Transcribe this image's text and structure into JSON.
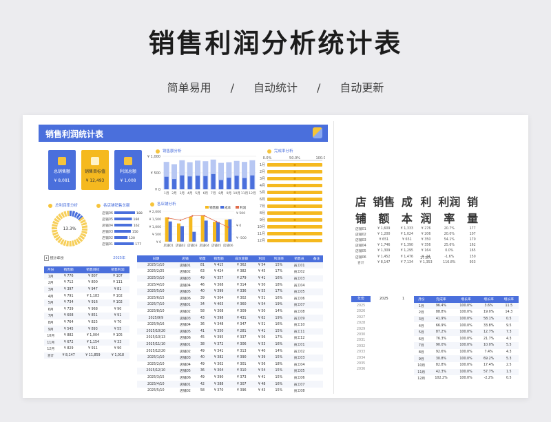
{
  "hero": {
    "title": "销售利润分析统计表",
    "tags": [
      "简单易用",
      "/",
      "自动统计",
      "/",
      "自动更新"
    ]
  },
  "dashboard": {
    "title": "销售利润统计表",
    "kpis": [
      {
        "label": "总销售额",
        "value": "¥ 8,081",
        "color": "#4a6fdc"
      },
      {
        "label": "销售目标值",
        "value": "¥ 12,493",
        "color": "#f5b91f"
      },
      {
        "label": "利润总额",
        "value": "¥ 1,008",
        "color": "#4a6fdc"
      }
    ],
    "panels": {
      "sales_trend": "销售额分析",
      "completion": "完成率分析",
      "profit_rate": "总利润率分析",
      "store_sales": "各店铺销售总额",
      "store_analysis": "各店铺分析"
    },
    "profit_rate_value": "13.3%"
  },
  "chart_data": [
    {
      "type": "bar",
      "title": "销售额分析",
      "categories": [
        "1月",
        "2月",
        "3月",
        "4月",
        "5月",
        "6月",
        "7月",
        "8月",
        "9月",
        "10月",
        "11月",
        "12月"
      ],
      "yticks": [
        "¥ 1,000",
        "¥ 500",
        "¥ 0"
      ],
      "ylim": [
        0,
        1000
      ],
      "series": [
        {
          "values": [
            830,
            760,
            880,
            820,
            870,
            850,
            900,
            800,
            820,
            860,
            830,
            880
          ]
        },
        {
          "values": [
            380,
            310,
            420,
            390,
            410,
            400,
            460,
            280,
            350,
            410,
            340,
            420
          ]
        }
      ]
    },
    {
      "type": "bar",
      "title": "完成率分析",
      "orientation": "horizontal",
      "categories": [
        "1月",
        "2月",
        "3月",
        "4月",
        "5月",
        "6月",
        "7月",
        "8月",
        "9月",
        "10月",
        "11月",
        "12月"
      ],
      "xticks": [
        "0.0%",
        "50.0%",
        "100.0%"
      ],
      "xlim": [
        0,
        1
      ],
      "values": [
        1.0,
        1.0,
        1.0,
        1.0,
        1.0,
        1.0,
        1.0,
        1.0,
        1.0,
        1.0,
        1.0,
        1.0
      ]
    },
    {
      "type": "bar",
      "title": "各店铺销售总额",
      "orientation": "horizontal",
      "categories": [
        "店铺06",
        "店铺05",
        "店铺04",
        "店铺03",
        "店铺02",
        "店铺01"
      ],
      "values": [
        188,
        160,
        162,
        150,
        120,
        177
      ]
    },
    {
      "type": "bar",
      "title": "各店铺分析",
      "categories": [
        "店铺01",
        "店铺02",
        "店铺03",
        "店铺04",
        "店铺05",
        "店铺06"
      ],
      "legend": [
        "销售额",
        "成本",
        "利润"
      ],
      "yticks_left": [
        "¥ 2,000",
        "¥ 1,500",
        "¥ 1,000",
        "¥ 500",
        "¥ 0"
      ],
      "yticks_right": [
        "¥ 500",
        "¥ 0",
        "¥ -500"
      ],
      "series": [
        {
          "name": "销售额",
          "values": [
            1609,
            1200,
            1651,
            1746,
            1309,
            1452
          ]
        },
        {
          "name": "成本",
          "values": [
            1333,
            1024,
            651,
            1390,
            1295,
            1476
          ]
        },
        {
          "name": "利润",
          "values": [
            276,
            206,
            350,
            356,
            164,
            -24
          ]
        }
      ]
    },
    {
      "type": "pie",
      "title": "总利润率分析",
      "values": [
        13.3,
        86.7
      ]
    }
  ],
  "year_panel": {
    "label": "统计年份",
    "year": "2025年",
    "headers": [
      "月份",
      "销售额",
      "销售目标",
      "销售利润"
    ],
    "rows": [
      [
        "1月",
        "¥ 776",
        "¥ 807",
        "¥ 107"
      ],
      [
        "2月",
        "¥ 712",
        "¥ 800",
        "¥ 111"
      ],
      [
        "3月",
        "¥ 397",
        "¥ 947",
        "¥ 81"
      ],
      [
        "4月",
        "¥ 791",
        "¥ 1,183",
        "¥ 102"
      ],
      [
        "5月",
        "¥ 734",
        "¥ 916",
        "¥ 102"
      ],
      [
        "6月",
        "¥ 739",
        "¥ 968",
        "¥ 90"
      ],
      [
        "7月",
        "¥ 608",
        "¥ 851",
        "¥ 91"
      ],
      [
        "8月",
        "¥ 764",
        "¥ 825",
        "¥ 70"
      ],
      [
        "9月",
        "¥ 545",
        "¥ 893",
        "¥ 55"
      ],
      [
        "10月",
        "¥ 882",
        "¥ 1,004",
        "¥ 105"
      ],
      [
        "11月",
        "¥ 672",
        "¥ 1,154",
        "¥ 33"
      ],
      [
        "12月",
        "¥ 829",
        "¥ 911",
        "¥ 90"
      ],
      [
        "合计",
        "¥ 8,147",
        "¥ 11,859",
        "¥ 1,018"
      ]
    ]
  },
  "records": {
    "headers": [
      "日期",
      "店铺",
      "销量",
      "销售额",
      "成本金额",
      "利润",
      "利润率",
      "销售员",
      "备注"
    ],
    "rows": [
      [
        "2025/1/10",
        "店铺01",
        "81",
        "¥ 415",
        "¥ 362",
        "¥ 54",
        "15%",
        "员工01",
        ""
      ],
      [
        "2025/2/25",
        "店铺02",
        "63",
        "¥ 424",
        "¥ 382",
        "¥ 45",
        "17%",
        "员工02",
        ""
      ],
      [
        "2025/3/10",
        "店铺03",
        "49",
        "¥ 357",
        "¥ 279",
        "¥ 41",
        "16%",
        "员工03",
        ""
      ],
      [
        "2025/4/10",
        "店铺04",
        "46",
        "¥ 368",
        "¥ 314",
        "¥ 50",
        "18%",
        "员工04",
        ""
      ],
      [
        "2025/5/10",
        "店铺05",
        "40",
        "¥ 399",
        "¥ 336",
        "¥ 55",
        "17%",
        "员工05",
        ""
      ],
      [
        "2025/6/15",
        "店铺06",
        "39",
        "¥ 304",
        "¥ 302",
        "¥ 51",
        "16%",
        "员工06",
        ""
      ],
      [
        "2025/7/10",
        "店铺01",
        "34",
        "¥ 403",
        "¥ 360",
        "¥ 54",
        "19%",
        "员工07",
        ""
      ],
      [
        "2025/8/10",
        "店铺02",
        "58",
        "¥ 308",
        "¥ 309",
        "¥ 50",
        "14%",
        "员工08",
        ""
      ],
      [
        "2025/9/9",
        "店铺03",
        "43",
        "¥ 398",
        "¥ 431",
        "¥ 62",
        "19%",
        "员工09",
        ""
      ],
      [
        "2025/9/16",
        "店铺04",
        "36",
        "¥ 348",
        "¥ 347",
        "¥ 51",
        "16%",
        "员工10",
        ""
      ],
      [
        "2025/10/20",
        "店铺05",
        "41",
        "¥ 350",
        "¥ 281",
        "¥ 41",
        "15%",
        "员工11",
        ""
      ],
      [
        "2025/10/13",
        "店铺06",
        "45",
        "¥ 395",
        "¥ 337",
        "¥ 56",
        "17%",
        "员工12",
        ""
      ],
      [
        "2025/11/10",
        "店铺01",
        "38",
        "¥ 372",
        "¥ 306",
        "¥ 53",
        "16%",
        "员工01",
        ""
      ],
      [
        "2025/12/20",
        "店铺02",
        "49",
        "¥ 341",
        "¥ 313",
        "¥ 40",
        "14%",
        "员工02",
        ""
      ],
      [
        "2025/1/10",
        "店铺03",
        "40",
        "¥ 382",
        "¥ 390",
        "¥ 39",
        "15%",
        "员工03",
        ""
      ],
      [
        "2025/2/10",
        "店铺04",
        "49",
        "¥ 302",
        "¥ 301",
        "¥ 56",
        "18%",
        "员工04",
        ""
      ],
      [
        "2025/12/10",
        "店铺05",
        "36",
        "¥ 304",
        "¥ 310",
        "¥ 54",
        "15%",
        "员工05",
        ""
      ],
      [
        "2025/3/15",
        "店铺06",
        "49",
        "¥ 390",
        "¥ 373",
        "¥ 41",
        "15%",
        "员工06",
        ""
      ],
      [
        "2025/4/10",
        "店铺01",
        "42",
        "¥ 388",
        "¥ 307",
        "¥ 48",
        "16%",
        "员工07",
        ""
      ],
      [
        "2025/5/10",
        "店铺02",
        "58",
        "¥ 370",
        "¥ 396",
        "¥ 43",
        "15%",
        "员工08",
        ""
      ]
    ]
  },
  "store_summary": {
    "headers": [
      "店铺",
      "销售额",
      "成本",
      "利润",
      "利润率",
      "销量"
    ],
    "rows": [
      [
        "店铺01",
        "¥ 1,609",
        "¥ 1,333",
        "¥ 276",
        "20.7%",
        "177"
      ],
      [
        "店铺02",
        "¥ 1,200",
        "¥ 1,024",
        "¥ 206",
        "20.0%",
        "107"
      ],
      [
        "店铺03",
        "¥ 651",
        "¥ 651",
        "¥ 350",
        "54.1%",
        "170"
      ],
      [
        "店铺04",
        "¥ 1,746",
        "¥ 1,390",
        "¥ 356",
        "25.6%",
        "162"
      ],
      [
        "店铺05",
        "¥ 1,309",
        "¥ 1,295",
        "¥ 164",
        "0.0%",
        "165"
      ],
      [
        "店铺06",
        "¥ 1,452",
        "¥ 1,476",
        "¥ -24",
        "-1.6%",
        "150"
      ],
      [
        "合计",
        "¥ 8,147",
        "¥ 7,134",
        "¥ 1,353",
        "116.8%",
        "933"
      ]
    ],
    "footnote": "17.0%"
  },
  "year_selector": {
    "label": "年份",
    "year": "2025",
    "index": "1"
  },
  "year_list": [
    "2025",
    "2026",
    "2027",
    "2028",
    "2029",
    "2030",
    "2031",
    "2032",
    "2033",
    "2034",
    "2035",
    "2036"
  ],
  "completion_table": {
    "headers": [
      "月份",
      "完成率",
      "增长率",
      "增长率",
      "增长率"
    ],
    "rows": [
      [
        "1月",
        "96.4%",
        "100.0%",
        "3.6%",
        "11.5"
      ],
      [
        "2月",
        "88.8%",
        "100.0%",
        "19.0%",
        "14.3"
      ],
      [
        "3月",
        "41.9%",
        "100.0%",
        "58.1%",
        "0.5"
      ],
      [
        "4月",
        "66.9%",
        "100.0%",
        "33.8%",
        "9.5"
      ],
      [
        "5月",
        "87.2%",
        "100.0%",
        "12.7%",
        "7.3"
      ],
      [
        "6月",
        "76.3%",
        "100.0%",
        "21.7%",
        "4.3"
      ],
      [
        "7月",
        "90.0%",
        "100.0%",
        "10.0%",
        "5.5"
      ],
      [
        "8月",
        "92.6%",
        "100.0%",
        "7.4%",
        "4.3"
      ],
      [
        "9月",
        "30.8%",
        "100.0%",
        "69.2%",
        "5.3"
      ],
      [
        "10月",
        "82.8%",
        "100.0%",
        "17.4%",
        "2.5"
      ],
      [
        "11月",
        "42.3%",
        "100.0%",
        "57.7%",
        "1.5"
      ],
      [
        "12月",
        "102.2%",
        "100.0%",
        "-2.2%",
        "0.5"
      ]
    ]
  },
  "colors": {
    "blue": "#4a6fdc",
    "light_blue": "#b7c7f3",
    "yellow": "#f5b91f",
    "bg": "#ececef"
  }
}
